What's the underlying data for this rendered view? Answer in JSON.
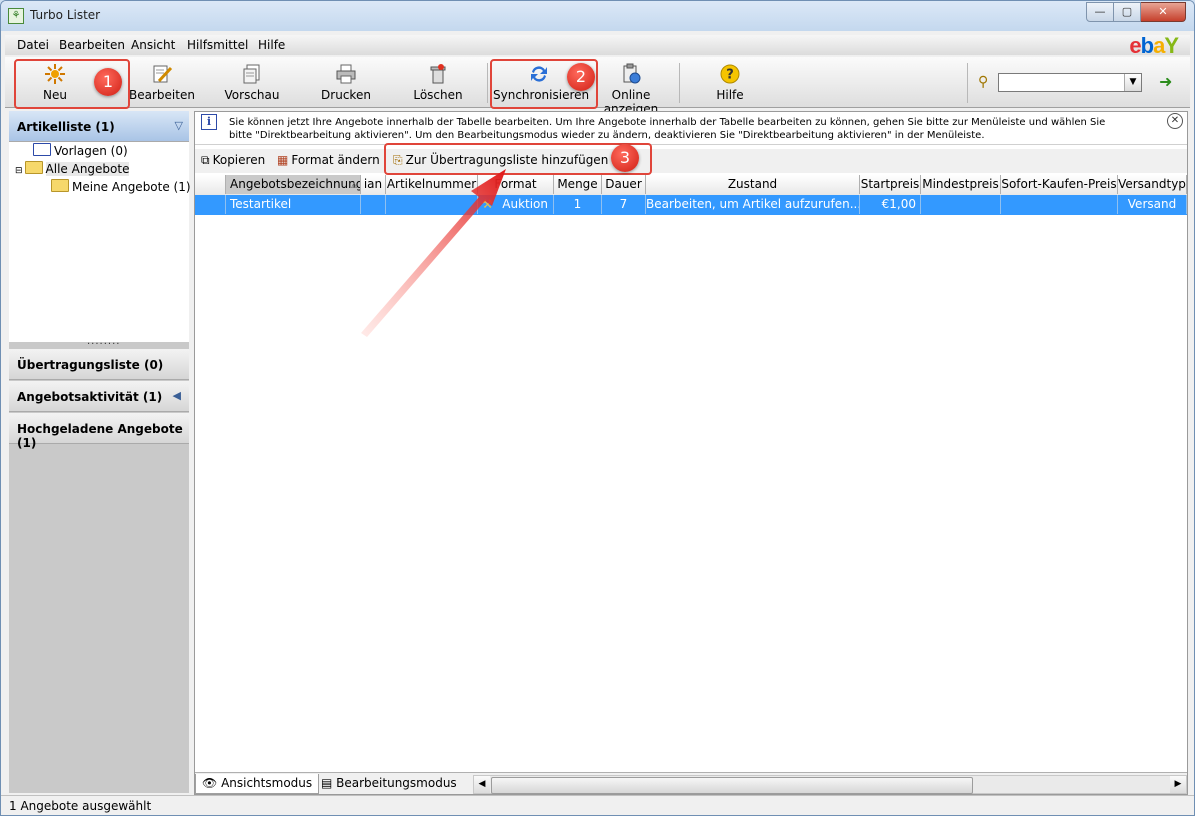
{
  "window": {
    "title": "Turbo Lister",
    "buttons": [
      "—",
      "▢",
      "✕"
    ]
  },
  "menu": [
    "Datei",
    "Bearbeiten",
    "Ansicht",
    "Hilfsmittel",
    "Hilfe"
  ],
  "ebay_logo": {
    "e": "e",
    "b": "b",
    "a": "a",
    "y": "Y"
  },
  "toolbar": {
    "new": "Neu",
    "edit": "Bearbeiten",
    "preview": "Vorschau",
    "print": "Drucken",
    "delete": "Löschen",
    "sync": "Synchronisieren",
    "online": "Online anzeigen",
    "help": "Hilfe",
    "search_value": ""
  },
  "sidebar": {
    "articles_header": "Artikelliste (1)",
    "tree": {
      "templates": "Vorlagen (0)",
      "all_offers": "Alle Angebote",
      "my_offers": "Meine Angebote (1)"
    },
    "splitter": "........",
    "transfer": "Übertragungsliste (0)",
    "activity": "Angebotsaktivität (1)",
    "uploaded": "Hochgeladene Angebote (1)"
  },
  "info": {
    "text": "Sie können jetzt Ihre Angebote innerhalb der Tabelle bearbeiten. Um Ihre Angebote innerhalb der Tabelle bearbeiten zu können, gehen Sie bitte zur Menüleiste und wählen Sie bitte \"Direktbearbeitung aktivieren\". Um den Bearbeitungsmodus wieder zu ändern, deaktivieren Sie \"Direktbearbeitung aktivieren\" in der Menüleiste."
  },
  "actions": {
    "copy": "Kopieren",
    "change_format": "Format ändern",
    "add_transfer": "Zur Übertragungsliste hinzufügen"
  },
  "grid": {
    "headers": [
      "",
      "Angebotsbezeichnung",
      "ian",
      "Artikelnummer",
      "Format",
      "Menge",
      "Dauer",
      "Zustand",
      "Startpreis",
      "Mindestpreis",
      "Sofort-Kaufen-Preis",
      "Versandtyp"
    ],
    "rows": [
      [
        "",
        "Testartikel",
        "",
        "",
        "Auktion",
        "1",
        "7",
        "Bearbeiten, um Artikel aufzurufen...",
        "€1,00",
        "",
        "",
        "Versand"
      ]
    ]
  },
  "tabs": {
    "view": "Ansichtsmodus",
    "edit": "Bearbeitungsmodus"
  },
  "status": "1 Angebote ausgewählt",
  "badges": [
    "1",
    "2",
    "3"
  ],
  "colors": {
    "selection": "#3399ff",
    "marker": "#e0453a"
  }
}
